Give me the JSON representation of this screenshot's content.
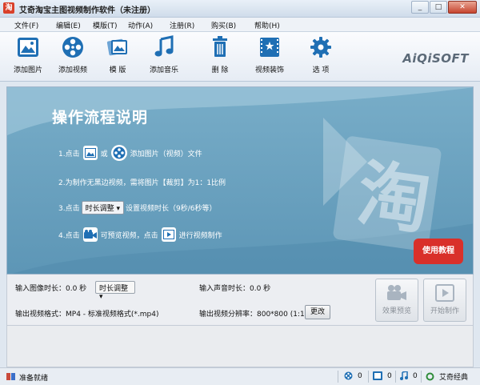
{
  "window": {
    "title": "艾奇淘宝主图视频制作软件（未注册）",
    "app_icon_glyph": "淘"
  },
  "menu": [
    "文件(F)",
    "编辑(E)",
    "模版(T)",
    "动作(A)",
    "注册(R)",
    "购买(B)",
    "帮助(H)"
  ],
  "toolbar": {
    "items": [
      {
        "label": "添加图片",
        "icon": "image-icon"
      },
      {
        "label": "添加视频",
        "icon": "film-reel-icon"
      },
      {
        "label": "模 版",
        "icon": "template-icon"
      },
      {
        "label": "添加音乐",
        "icon": "music-note-icon"
      },
      {
        "label": "删 除",
        "icon": "trash-icon"
      },
      {
        "label": "视频装饰",
        "icon": "film-decor-icon"
      },
      {
        "label": "选 项",
        "icon": "gear-icon"
      }
    ],
    "brand": "AiQiSOFT"
  },
  "guide": {
    "title": "操作流程说明",
    "step1": {
      "prefix": "1.点击",
      "mid": "或",
      "suffix": "添加图片（视频）文件"
    },
    "step2": "2.为制作无黑边视频，需将图片【裁剪】为1：1比例",
    "step3": {
      "prefix": "3.点击",
      "select": "时长调整",
      "suffix": "设置视频时长（9秒/6秒等）"
    },
    "step4": {
      "prefix": "4.点击",
      "mid": "可预览视频，点击",
      "suffix": "进行视频制作"
    },
    "tutorial_button": "使用教程"
  },
  "settings": {
    "image_duration": "输入图像时长：0.0 秒",
    "duration_select": "时长调整",
    "audio_duration": "输入声音时长：0.0 秒",
    "output_format": "输出视频格式：MP4 - 标准视频格式(*.mp4)",
    "output_resolution": "输出视频分辨率：800*800 (1:1)",
    "change_button": "更改",
    "preview_button": "效果预览",
    "start_button": "开始制作"
  },
  "status": {
    "text": "准备就绪",
    "video_count": "0",
    "image_count": "0",
    "music_count": "0",
    "brand": "艾奇经典"
  },
  "colors": {
    "accent_blue": "#1f6fb4",
    "banner_blue": "#6aa3c2",
    "tutorial_red": "#d9302a"
  }
}
